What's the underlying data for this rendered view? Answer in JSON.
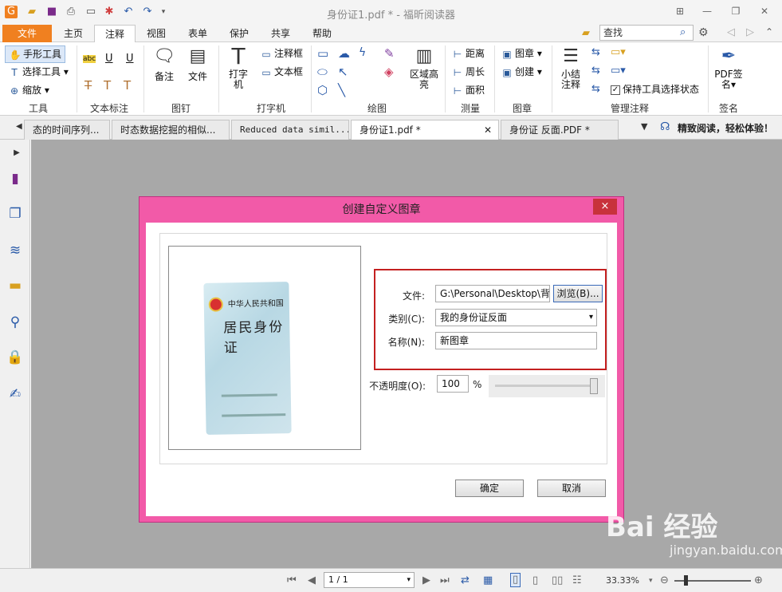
{
  "window": {
    "title": "身份证1.pdf * - 福昕阅读器",
    "qa_icons": [
      "app-logo-icon",
      "open-folder-icon",
      "save-icon",
      "print-icon",
      "scan-icon",
      "new-icon",
      "undo-icon",
      "redo-icon",
      "dropdown-icon"
    ]
  },
  "menu": {
    "tabs": [
      "文件",
      "主页",
      "注释",
      "视图",
      "表单",
      "保护",
      "共享",
      "帮助"
    ],
    "active": "注释",
    "search_value": "查找"
  },
  "ribbon": {
    "tools": {
      "hand": "手形工具",
      "select": "选择工具",
      "zoom": "缩放",
      "group": "工具"
    },
    "text_markup": {
      "group": "文本标注",
      "abc": "abc"
    },
    "pin": {
      "note": "备注",
      "file": "文件",
      "group": "图钉"
    },
    "typewriter": {
      "typewriter": "打字机",
      "callout": "注释框",
      "textbox": "文本框",
      "group": "打字机"
    },
    "drawing": {
      "area_highlight": "区域高亮",
      "group": "绘图"
    },
    "measure": {
      "distance": "距离",
      "perimeter": "周长",
      "area": "面积",
      "group": "测量"
    },
    "stamp": {
      "stamp": "图章",
      "create": "创建",
      "group": "图章"
    },
    "manage": {
      "summary": "小结注释",
      "keep_tool": "保持工具选择状态",
      "group": "管理注释"
    },
    "sign": {
      "pdf_sign": "PDF签名",
      "group": "签名"
    }
  },
  "doc_tabs": [
    {
      "label": "态的时间序列..."
    },
    {
      "label": "时态数据挖掘的相似..."
    },
    {
      "label": "Reduced data simil..."
    },
    {
      "label": "身份证1.pdf *"
    },
    {
      "label": "身份证 反面.PDF *"
    }
  ],
  "promo": "精致阅读，轻松体验！",
  "dialog": {
    "title": "创建自定义图章",
    "close": "×",
    "file_label": "文件:",
    "file_value": "G:\\Personal\\Desktop\\背面",
    "browse": "浏览(B)...",
    "category_label": "类别(C):",
    "category_value": "我的身份证反面",
    "name_label": "名称(N):",
    "name_value": "新图章",
    "opacity_label": "不透明度(O):",
    "opacity_value": "100",
    "opacity_unit": "%",
    "ok": "确定",
    "cancel": "取消",
    "card_title": "中华人民共和国",
    "card_subtitle": "居民身份证"
  },
  "status": {
    "page_value": "1 / 1",
    "zoom_value": "33.33%"
  },
  "watermark": {
    "main": "Bai 经验",
    "sub": "jingyan.baidu.com"
  }
}
